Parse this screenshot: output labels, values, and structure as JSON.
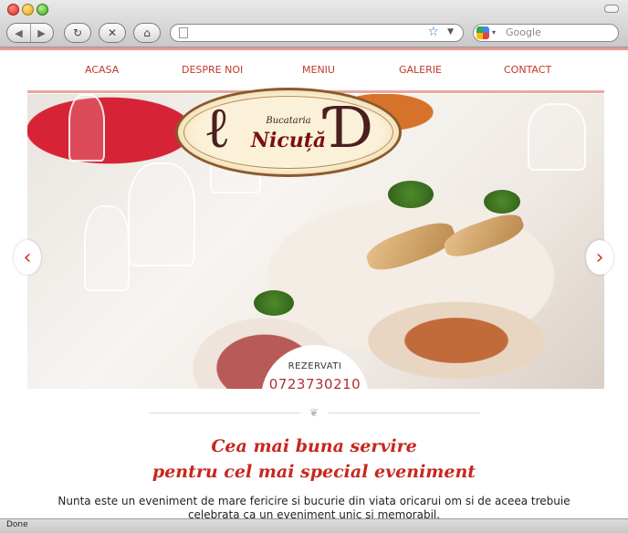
{
  "browser": {
    "window_controls": [
      "close",
      "minimize",
      "zoom"
    ],
    "url": "",
    "search_placeholder": "Google",
    "status": "Done"
  },
  "menu": {
    "items": [
      {
        "label": "ACASA"
      },
      {
        "label": "DESPRE NOI"
      },
      {
        "label": "MENIU"
      },
      {
        "label": "GALERIE"
      },
      {
        "label": "CONTACT"
      }
    ]
  },
  "hero": {
    "logo_line1": "Bucataria",
    "logo_line2": "Nicuță",
    "reservation_label": "REZERVATI",
    "reservation_phone": "0723730210"
  },
  "content": {
    "headline_line1": "Cea mai buna servire",
    "headline_line2": "pentru cel mai special eveniment",
    "paragraph": "Nunta este un eveniment de mare fericire si bucurie din viata oricarui om si de aceea trebuie celebrata ca un eveniment unic si memorabil."
  },
  "colors": {
    "accent": "#c0392b",
    "menu_line": "#e8a89e",
    "headline": "#c8261e"
  }
}
